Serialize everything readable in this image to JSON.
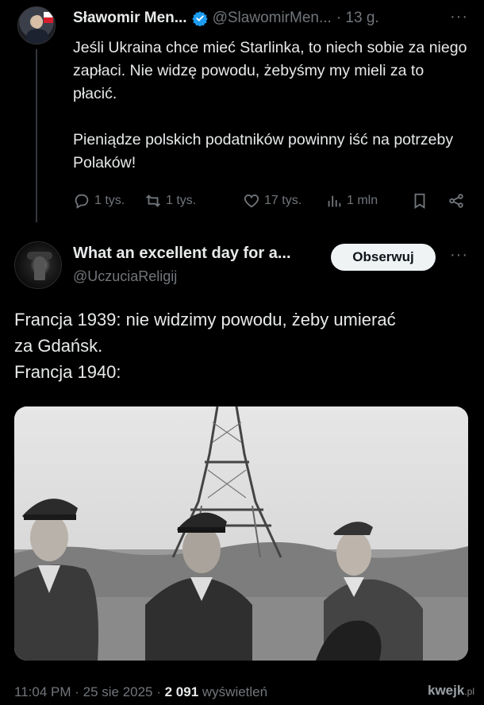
{
  "tweet1": {
    "author_name": "Sławomir Men...",
    "author_handle": "@SlawomirMen...",
    "time": "· 13 g.",
    "more": "···",
    "paragraphs": [
      "Jeśli Ukraina chce mieć Starlinka, to niech sobie za niego zapłaci. Nie widzę powodu, żebyśmy my mieli za to płacić.",
      "Pieniądze polskich podatników powinny iść na potrzeby Polaków!"
    ],
    "replies": "1 tys.",
    "reposts": "1 tys.",
    "likes": "17 tys.",
    "views": "1 mln"
  },
  "tweet2": {
    "author_name": "What an excellent day for a...",
    "author_handle": "@UczuciaReligij",
    "follow_label": "Obserwuj",
    "more": "···",
    "lines": [
      "Francja 1939: nie widzimy powodu, żeby umierać",
      "za Gdańsk.",
      "Francja 1940:"
    ],
    "meta_time": "11:04 PM · 25 sie 2025 · ",
    "meta_views_count": "2 091",
    "meta_views_label": " wyświetleń"
  },
  "watermark": {
    "brand": "kwejk",
    "suffix": ".pl"
  },
  "colors": {
    "background": "#000000",
    "text": "#e7e9ea",
    "muted": "#71767b",
    "verified": "#1d9bf0",
    "follow_button": "#eff3f4"
  },
  "icons": [
    "verified-badge-icon",
    "reply-icon",
    "repost-icon",
    "like-icon",
    "views-icon",
    "bookmark-icon",
    "share-icon",
    "more-icon"
  ]
}
